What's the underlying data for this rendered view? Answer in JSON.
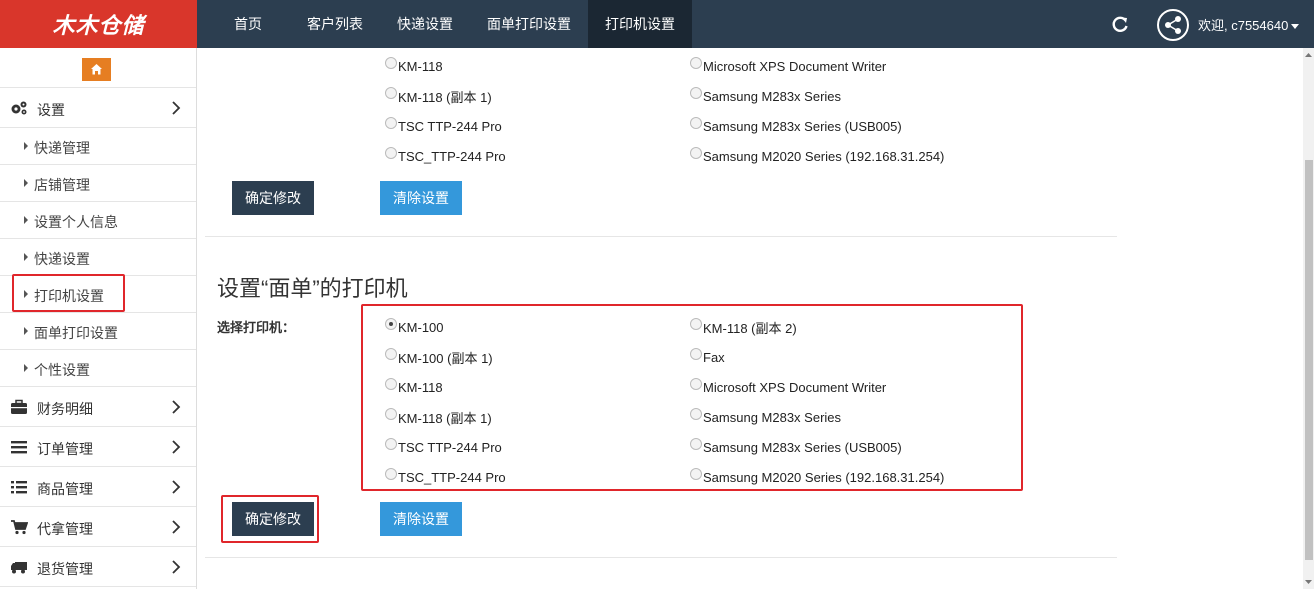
{
  "header": {
    "logo_text": "木木仓储",
    "nav": [
      "首页",
      "客户列表",
      "快递设置",
      "面单打印设置",
      "打印机设置"
    ],
    "active_nav": "打印机设置",
    "user_label": "欢迎, c7554640"
  },
  "sidebar": {
    "settings_label": "设置",
    "sub_items": [
      "快递管理",
      "店铺管理",
      "设置个人信息",
      "快递设置",
      "打印机设置",
      "面单打印设置",
      "个性设置"
    ],
    "groups": [
      "财务明细",
      "订单管理",
      "商品管理",
      "代拿管理",
      "退货管理"
    ]
  },
  "section1": {
    "left_printers": [
      "KM-118",
      "KM-118 (副本 1)",
      "TSC TTP-244 Pro",
      "TSC_TTP-244 Pro"
    ],
    "right_printers": [
      "Microsoft XPS Document Writer",
      "Samsung M283x Series",
      "Samsung M283x Series (USB005)",
      "Samsung M2020 Series (192.168.31.254)"
    ],
    "confirm_label": "确定修改",
    "clear_label": "清除设置"
  },
  "section2": {
    "title": "设置“面单”的打印机",
    "select_label": "选择打印机：",
    "left_printers": [
      "KM-100",
      "KM-100 (副本 1)",
      "KM-118",
      "KM-118 (副本 1)",
      "TSC TTP-244 Pro",
      "TSC_TTP-244 Pro"
    ],
    "right_printers": [
      "KM-118 (副本 2)",
      "Fax",
      "Microsoft XPS Document Writer",
      "Samsung M283x Series",
      "Samsung M283x Series (USB005)",
      "Samsung M2020 Series (192.168.31.254)"
    ],
    "selected": "KM-100",
    "confirm_label": "确定修改",
    "clear_label": "清除设置"
  },
  "colors": {
    "topbar": "#2c3e50",
    "logo_bg": "#d9362b",
    "highlight": "#e0262b",
    "primary_button": "#2c3e50",
    "secondary_button": "#3498db",
    "home_button": "#e67e22"
  }
}
